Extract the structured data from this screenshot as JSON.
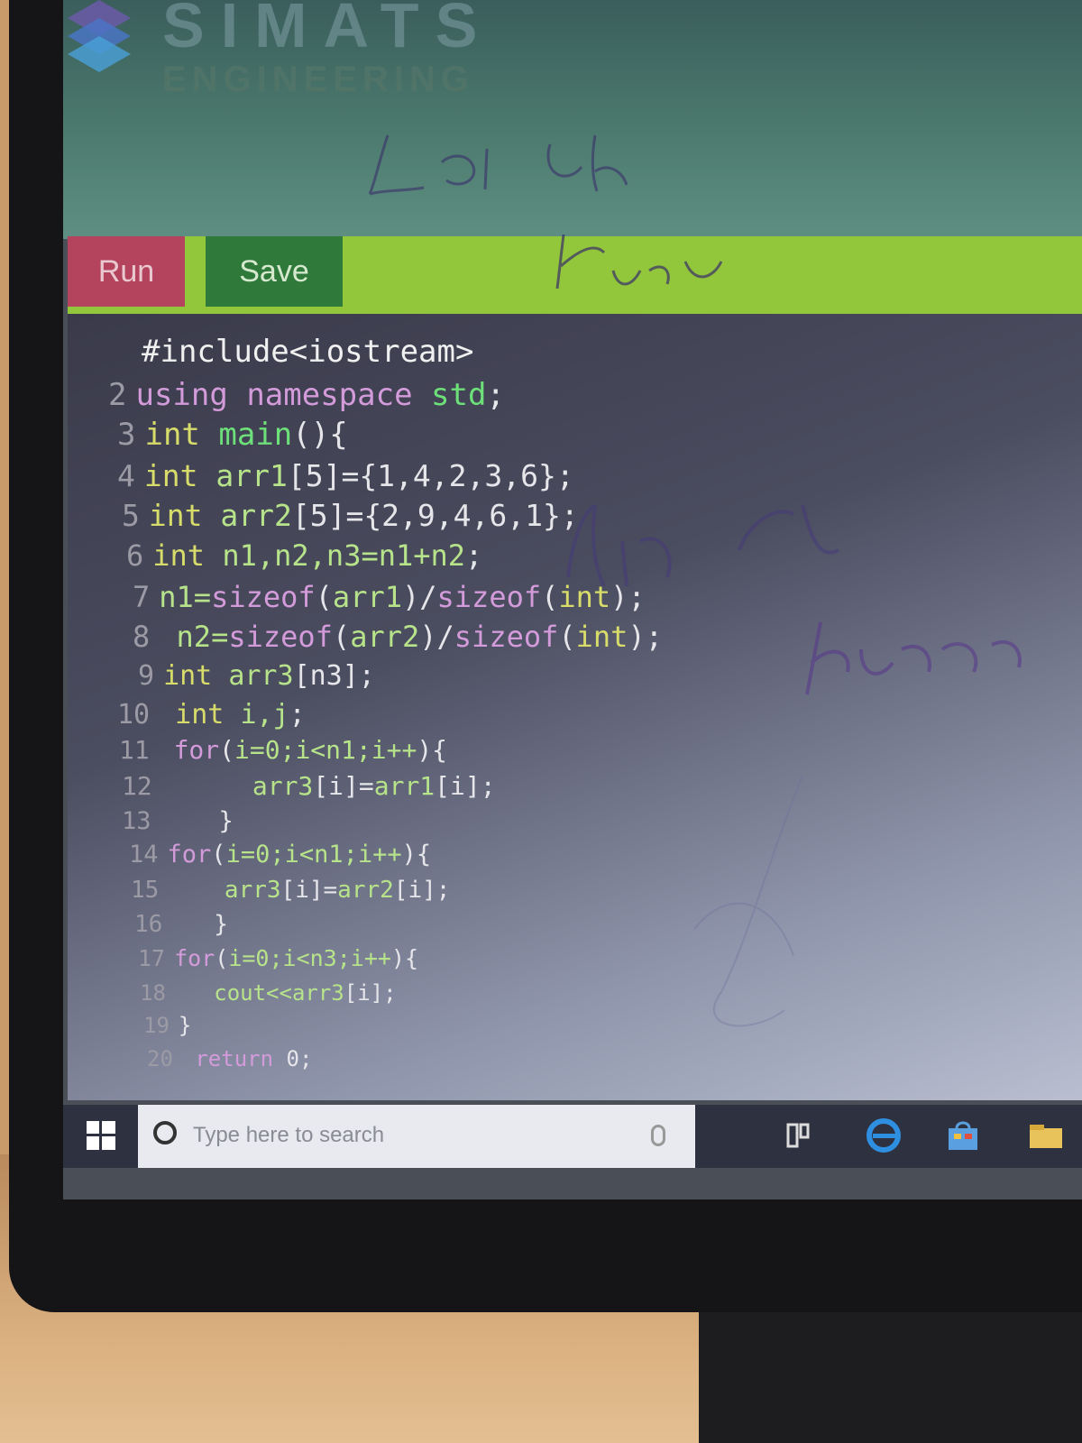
{
  "header": {
    "brand_text": "SIMATS",
    "brand_sub": "ENGINEERING",
    "handwritten_1": "Lin 6h",
    "handwritten_2": "Kumar",
    "handwritten_3": "Lin esh",
    "handwritten_4": "Kumar"
  },
  "toolbar": {
    "run_label": "Run",
    "save_label": "Save"
  },
  "editor": {
    "lines": [
      {
        "n": "",
        "tokens": [
          {
            "c": "pp",
            "t": "#include<iostream>"
          }
        ]
      },
      {
        "n": "2",
        "tokens": [
          {
            "c": "kw",
            "t": "using "
          },
          {
            "c": "kw",
            "t": "namespace "
          },
          {
            "c": "fn",
            "t": "std"
          },
          {
            "c": "op",
            "t": ";"
          }
        ]
      },
      {
        "n": "3",
        "tokens": [
          {
            "c": "ty",
            "t": "int "
          },
          {
            "c": "fn",
            "t": "main"
          },
          {
            "c": "op",
            "t": "(){"
          }
        ]
      },
      {
        "n": "4",
        "tokens": [
          {
            "c": "ty",
            "t": "int "
          },
          {
            "c": "tx",
            "t": "arr1"
          },
          {
            "c": "op",
            "t": "[5]={1,4,2,3,6};"
          }
        ]
      },
      {
        "n": "5",
        "tokens": [
          {
            "c": "ty",
            "t": "int "
          },
          {
            "c": "tx",
            "t": "arr2"
          },
          {
            "c": "op",
            "t": "[5]={2,9,4,6,1};"
          }
        ]
      },
      {
        "n": "6",
        "tokens": [
          {
            "c": "ty",
            "t": "int "
          },
          {
            "c": "tx",
            "t": "n1,n2,n3=n1+n2"
          },
          {
            "c": "op",
            "t": ";"
          }
        ]
      },
      {
        "n": "7",
        "tokens": [
          {
            "c": "tx",
            "t": "n1="
          },
          {
            "c": "kw",
            "t": "sizeof"
          },
          {
            "c": "op",
            "t": "("
          },
          {
            "c": "tx",
            "t": "arr1"
          },
          {
            "c": "op",
            "t": ")/"
          },
          {
            "c": "kw",
            "t": "sizeof"
          },
          {
            "c": "op",
            "t": "("
          },
          {
            "c": "ty",
            "t": "int"
          },
          {
            "c": "op",
            "t": ");"
          }
        ]
      },
      {
        "n": "8",
        "tokens": [
          {
            "c": "tx",
            "t": " n2="
          },
          {
            "c": "kw",
            "t": "sizeof"
          },
          {
            "c": "op",
            "t": "("
          },
          {
            "c": "tx",
            "t": "arr2"
          },
          {
            "c": "op",
            "t": ")/"
          },
          {
            "c": "kw",
            "t": "sizeof"
          },
          {
            "c": "op",
            "t": "("
          },
          {
            "c": "ty",
            "t": "int"
          },
          {
            "c": "op",
            "t": ");"
          }
        ]
      },
      {
        "n": "9",
        "tokens": [
          {
            "c": "ty",
            "t": "int "
          },
          {
            "c": "tx",
            "t": "arr3"
          },
          {
            "c": "op",
            "t": "[n3];"
          }
        ]
      },
      {
        "n": "10",
        "tokens": [
          {
            "c": "ty",
            "t": " int "
          },
          {
            "c": "tx",
            "t": "i,j"
          },
          {
            "c": "op",
            "t": ";"
          }
        ]
      },
      {
        "n": "11",
        "tokens": [
          {
            "c": "kw",
            "t": " for"
          },
          {
            "c": "op",
            "t": "("
          },
          {
            "c": "tx",
            "t": "i=0;i<n1;i++"
          },
          {
            "c": "op",
            "t": "){"
          }
        ]
      },
      {
        "n": "12",
        "tokens": [
          {
            "c": "tx",
            "t": "      arr3"
          },
          {
            "c": "op",
            "t": "[i]="
          },
          {
            "c": "tx",
            "t": "arr1"
          },
          {
            "c": "op",
            "t": "[i];"
          }
        ]
      },
      {
        "n": "13",
        "tokens": [
          {
            "c": "op",
            "t": "    }"
          }
        ]
      },
      {
        "n": "14",
        "tokens": [
          {
            "c": "kw",
            "t": "for"
          },
          {
            "c": "op",
            "t": "("
          },
          {
            "c": "tx",
            "t": "i=0;i<n1;i++"
          },
          {
            "c": "op",
            "t": "){"
          }
        ]
      },
      {
        "n": "15",
        "tokens": [
          {
            "c": "tx",
            "t": "    arr3"
          },
          {
            "c": "op",
            "t": "[i]="
          },
          {
            "c": "tx",
            "t": "arr2"
          },
          {
            "c": "op",
            "t": "[i];"
          }
        ]
      },
      {
        "n": "16",
        "tokens": [
          {
            "c": "op",
            "t": "   }"
          }
        ]
      },
      {
        "n": "17",
        "tokens": [
          {
            "c": "kw",
            "t": "for"
          },
          {
            "c": "op",
            "t": "("
          },
          {
            "c": "tx",
            "t": "i=0;i<n3;i++"
          },
          {
            "c": "op",
            "t": "){"
          }
        ]
      },
      {
        "n": "18",
        "tokens": [
          {
            "c": "tx",
            "t": "   cout<<arr3"
          },
          {
            "c": "op",
            "t": "[i];"
          }
        ]
      },
      {
        "n": "19",
        "tokens": [
          {
            "c": "op",
            "t": "}"
          }
        ]
      },
      {
        "n": "20",
        "tokens": [
          {
            "c": "kw",
            "t": " return "
          },
          {
            "c": "op",
            "t": "0;"
          }
        ]
      }
    ]
  },
  "taskbar": {
    "search_placeholder": "Type here to search",
    "icons": [
      "windows-start-icon",
      "search-icon",
      "microphone-icon",
      "task-view-icon",
      "edge-browser-icon",
      "store-icon",
      "file-explorer-icon"
    ]
  }
}
